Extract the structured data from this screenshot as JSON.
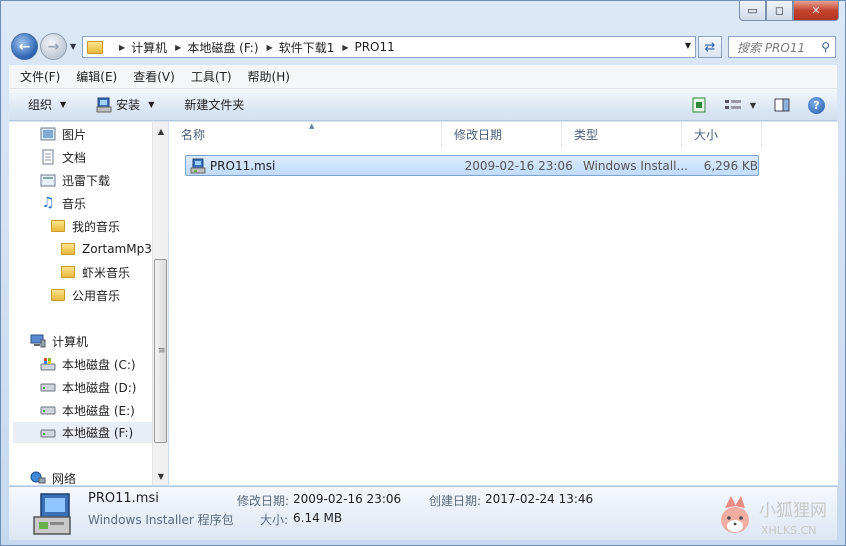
{
  "window": {
    "controls": {
      "minimize": "▭",
      "maximize": "◻",
      "close": "✕"
    }
  },
  "address": {
    "segments": [
      "计算机",
      "本地磁盘 (F:)",
      "软件下载1",
      "PRO11"
    ],
    "search_placeholder": "搜索 PRO11"
  },
  "menu": [
    "文件(F)",
    "编辑(E)",
    "查看(V)",
    "工具(T)",
    "帮助(H)"
  ],
  "toolbar": {
    "organize": "组织",
    "install": "安装",
    "new_folder": "新建文件夹"
  },
  "navpane": {
    "items": [
      {
        "label": "图片",
        "icon": "pictures-icon"
      },
      {
        "label": "文档",
        "icon": "documents-icon"
      },
      {
        "label": "迅雷下载",
        "icon": "library-icon"
      },
      {
        "label": "音乐",
        "icon": "music-icon"
      },
      {
        "label": "我的音乐",
        "icon": "folder-icon"
      },
      {
        "label": "ZortamMp3",
        "icon": "folder-icon"
      },
      {
        "label": "虾米音乐",
        "icon": "folder-icon"
      },
      {
        "label": "公用音乐",
        "icon": "folder-icon"
      },
      {
        "label": "计算机",
        "icon": "computer-icon"
      },
      {
        "label": "本地磁盘 (C:)",
        "icon": "system-drive-icon"
      },
      {
        "label": "本地磁盘 (D:)",
        "icon": "drive-icon"
      },
      {
        "label": "本地磁盘 (E:)",
        "icon": "drive-icon"
      },
      {
        "label": "本地磁盘 (F:)",
        "icon": "drive-icon"
      },
      {
        "label": "网络",
        "icon": "network-icon"
      }
    ]
  },
  "columns": {
    "name": "名称",
    "modified": "修改日期",
    "type": "类型",
    "size": "大小"
  },
  "files": [
    {
      "name": "PRO11.msi",
      "modified": "2009-02-16 23:06",
      "type": "Windows Install...",
      "size": "6,296 KB"
    }
  ],
  "details": {
    "name": "PRO11.msi",
    "type": "Windows Installer 程序包",
    "modified_label": "修改日期:",
    "modified": "2009-02-16 23:06",
    "created_label": "创建日期:",
    "created": "2017-02-24 13:46",
    "size_label": "大小:",
    "size": "6.14 MB"
  },
  "watermark": {
    "text_cn": "小狐狸网",
    "text_en": "XHLKS.CN"
  }
}
